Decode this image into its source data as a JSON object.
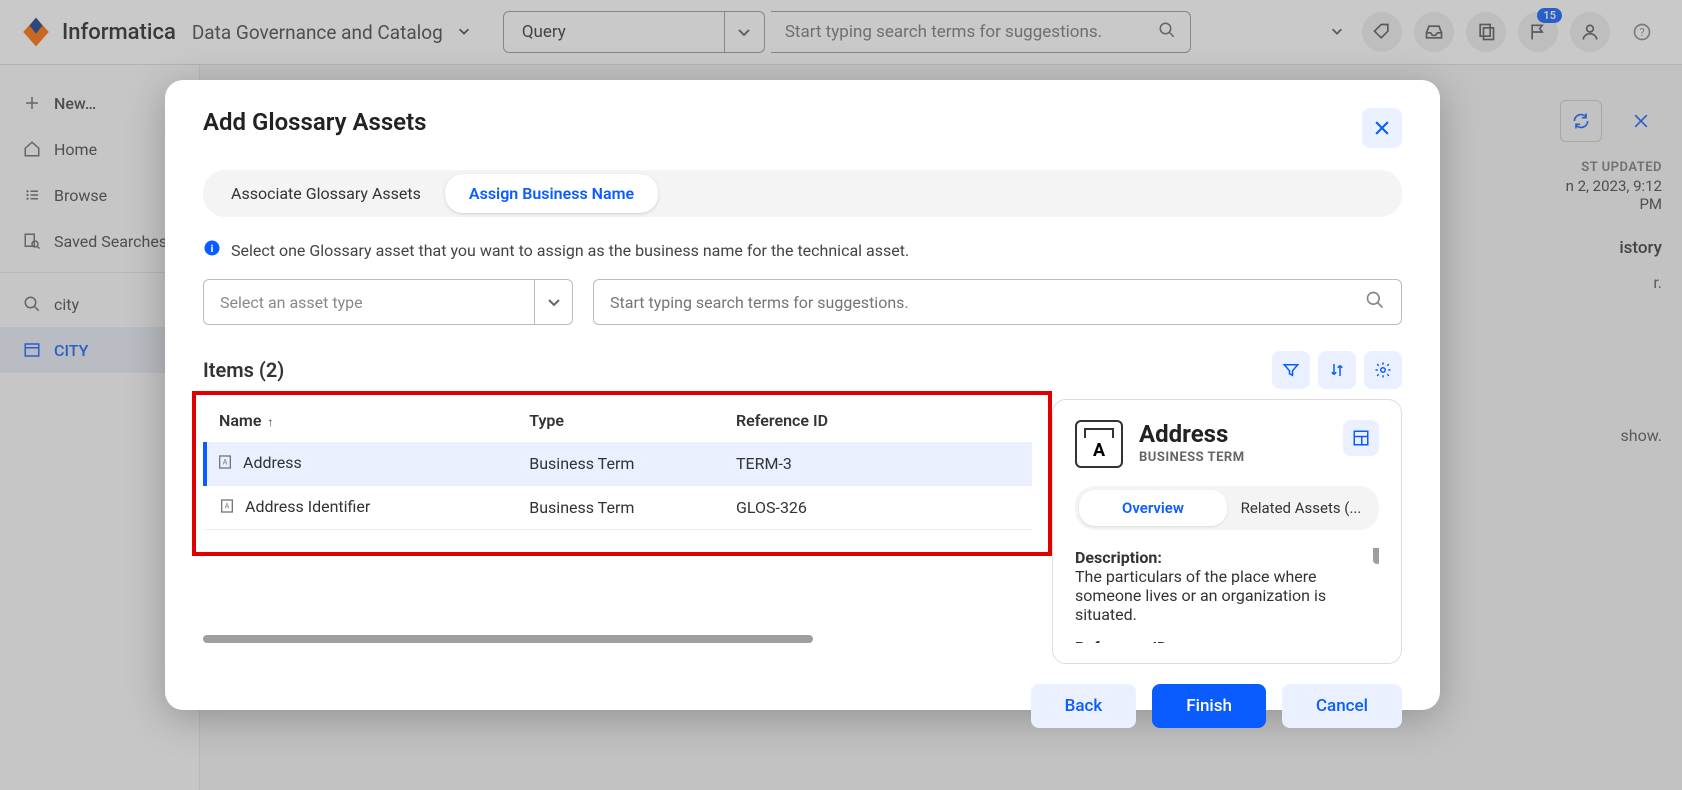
{
  "header": {
    "brand": "Informatica",
    "product": "Data Governance and Catalog",
    "query_label": "Query",
    "search_placeholder": "Start typing search terms for suggestions.",
    "notification_count": "15"
  },
  "sidebar": {
    "new": "New…",
    "home": "Home",
    "browse": "Browse",
    "saved": "Saved Searches",
    "search_term": "city",
    "active": "CITY"
  },
  "background": {
    "updated_label": "ST UPDATED",
    "updated_value": "n 2, 2023, 9:12 PM",
    "history_tab": "istory",
    "r_text": "r.",
    "show_text": "show."
  },
  "dialog": {
    "title": "Add Glossary Assets",
    "tab1": "Associate Glossary Assets",
    "tab2": "Assign Business Name",
    "info": "Select one Glossary asset that you want to assign as the business name for the technical asset.",
    "asset_type_placeholder": "Select an asset type",
    "search_placeholder": "Start typing search terms for suggestions.",
    "items_label": "Items (2)",
    "columns": {
      "name": "Name",
      "type": "Type",
      "ref": "Reference ID"
    },
    "rows": [
      {
        "name": "Address",
        "type": "Business Term",
        "ref": "TERM-3",
        "selected": true
      },
      {
        "name": "Address Identifier",
        "type": "Business Term",
        "ref": "GLOS-326",
        "selected": false
      }
    ],
    "detail": {
      "title": "Address",
      "subtitle": "BUSINESS TERM",
      "tab_overview": "Overview",
      "tab_related": "Related Assets (...",
      "desc_label": "Description:",
      "desc_text": "The particulars of the place where someone lives or an organization is situated.",
      "ref_label": "Reference ID:"
    },
    "footer": {
      "back": "Back",
      "finish": "Finish",
      "cancel": "Cancel"
    }
  }
}
